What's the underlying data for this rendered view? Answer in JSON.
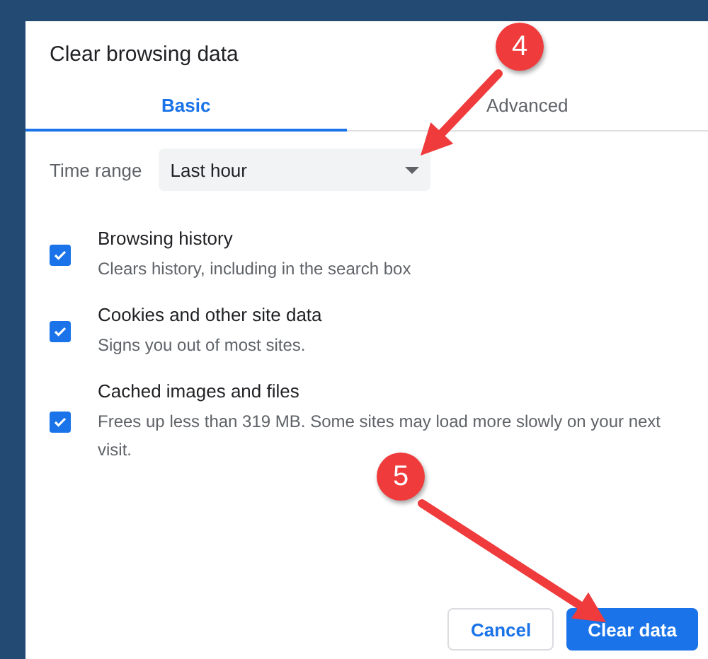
{
  "dialog": {
    "title": "Clear browsing data"
  },
  "tabs": [
    {
      "label": "Basic",
      "selected": true
    },
    {
      "label": "Advanced",
      "selected": false
    }
  ],
  "time_range": {
    "label": "Time range",
    "value": "Last hour"
  },
  "options": [
    {
      "title": "Browsing history",
      "description": "Clears history, including in the search box",
      "checked": true
    },
    {
      "title": "Cookies and other site data",
      "description": "Signs you out of most sites.",
      "checked": true
    },
    {
      "title": "Cached images and files",
      "description": "Frees up less than 319 MB. Some sites may load more slowly on your next visit.",
      "checked": true
    }
  ],
  "buttons": [
    {
      "label": "Cancel",
      "kind": "secondary"
    },
    {
      "label": "Clear data",
      "kind": "primary"
    }
  ],
  "callouts": [
    {
      "number": "4"
    },
    {
      "number": "5"
    }
  ]
}
